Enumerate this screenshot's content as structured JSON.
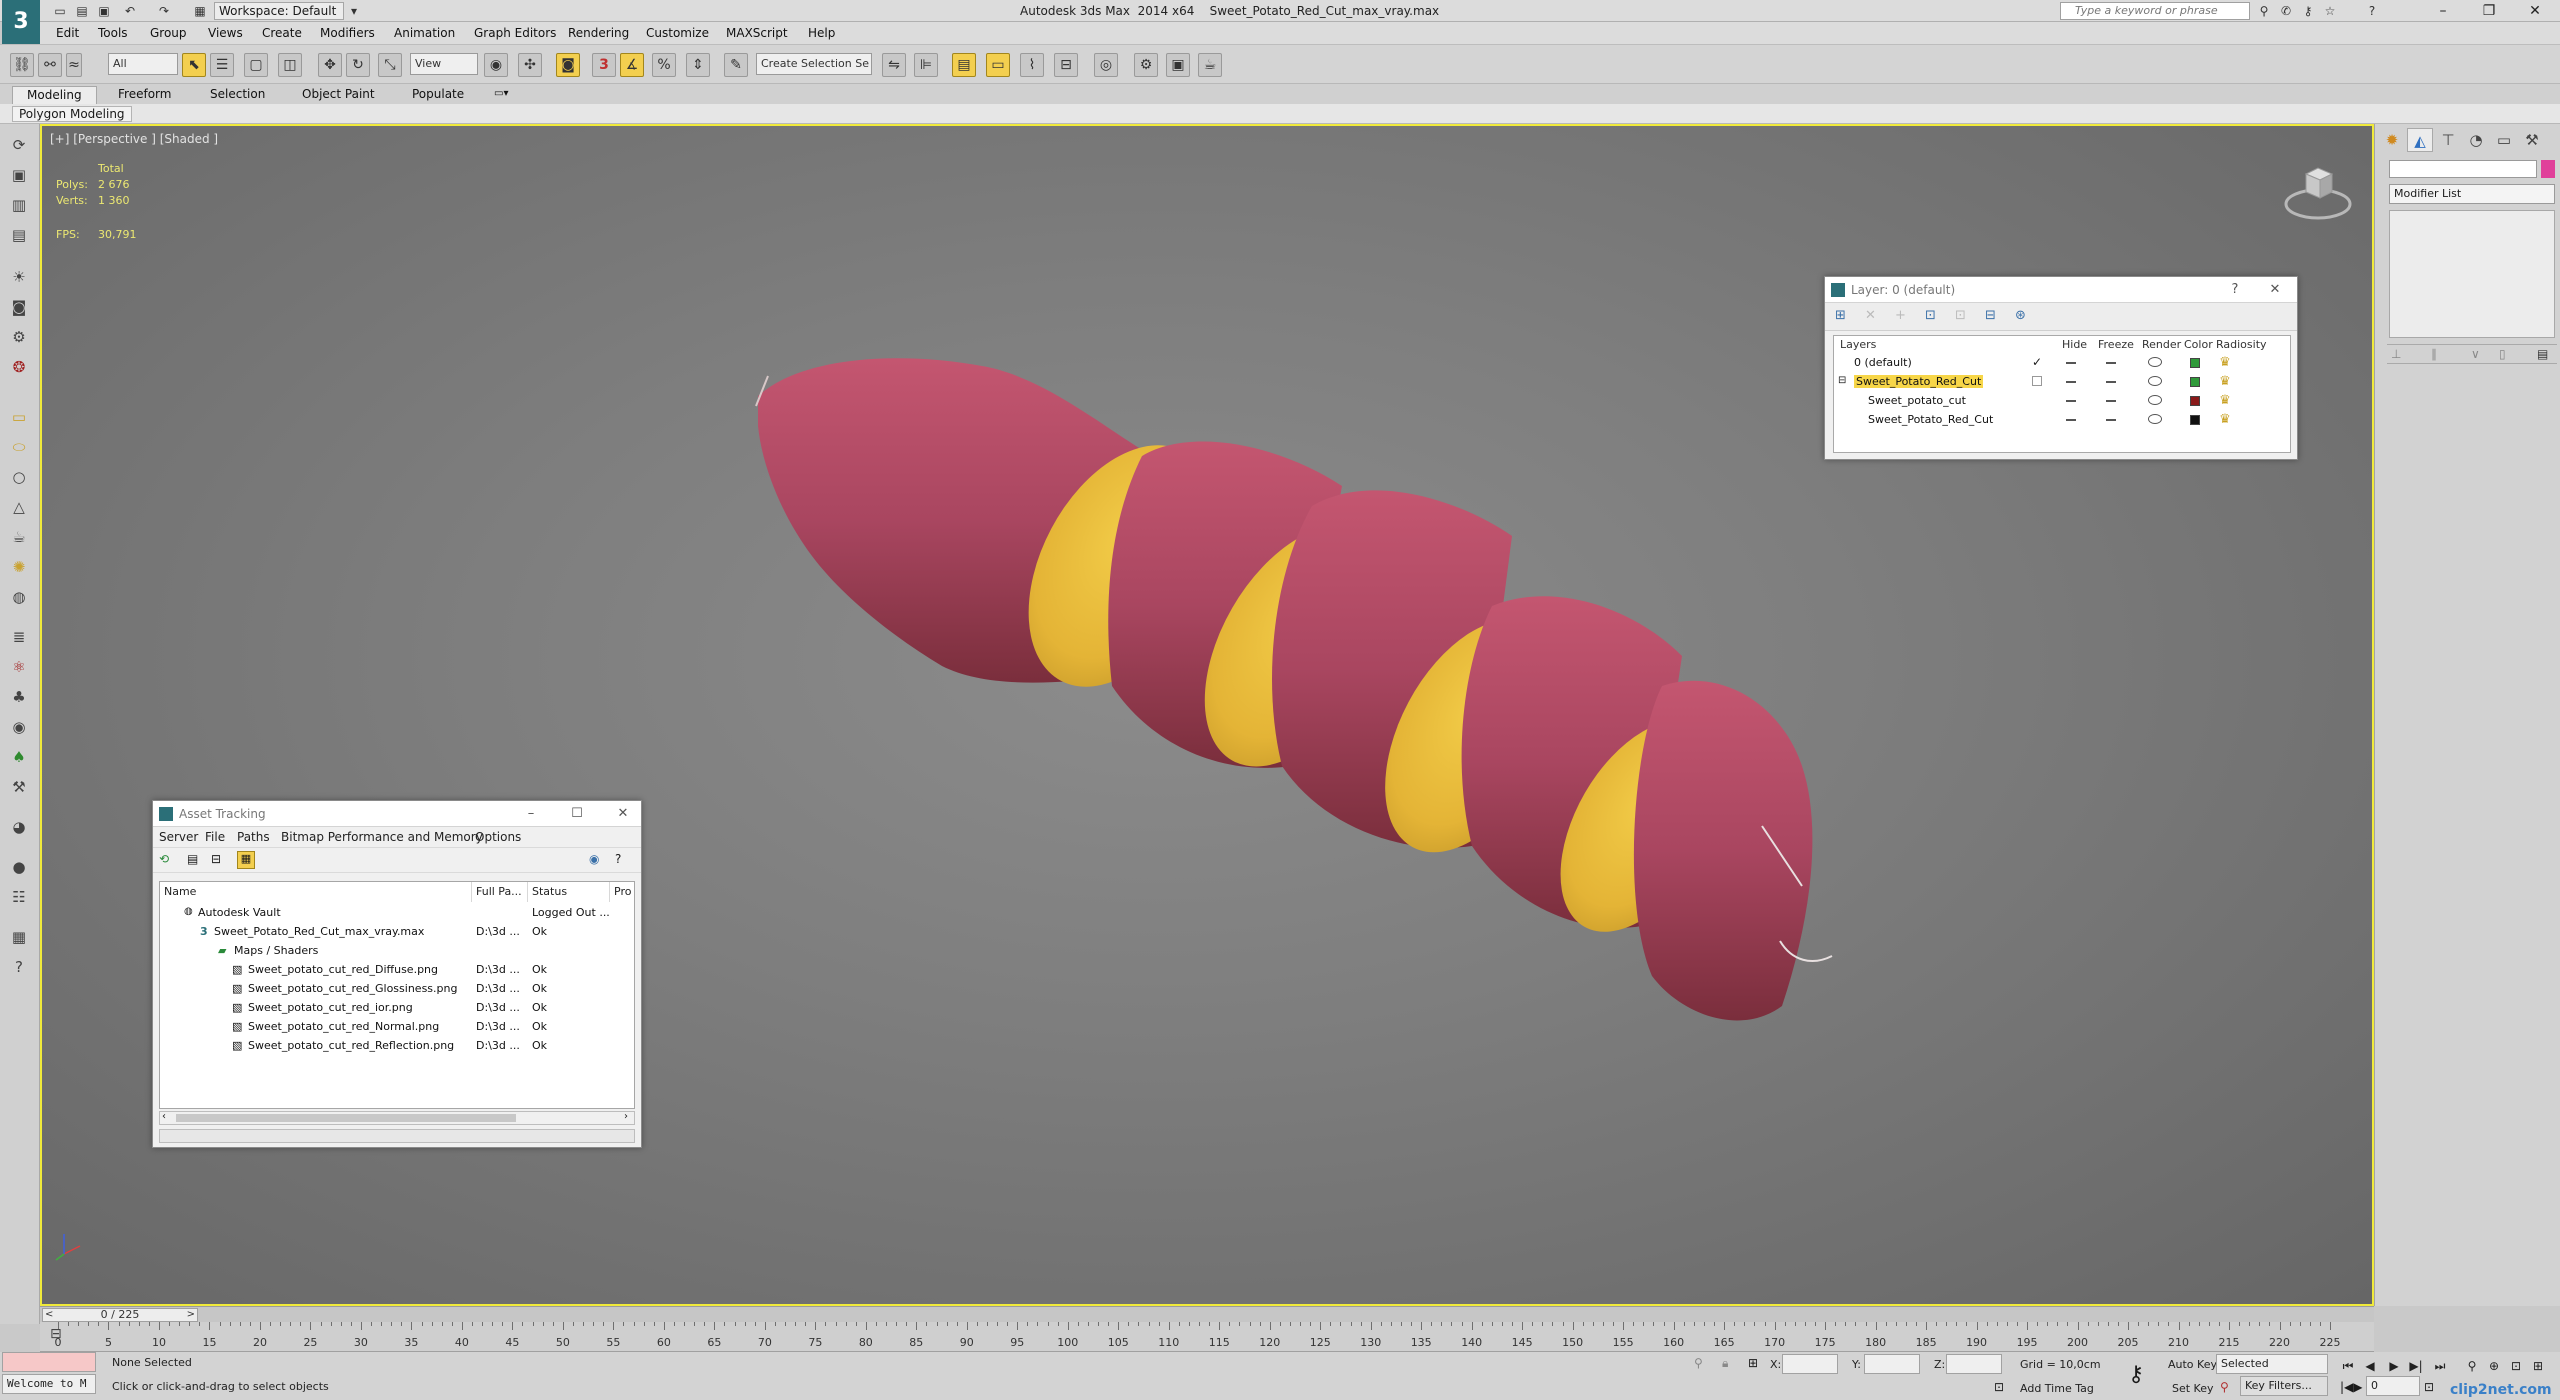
{
  "titlebar": {
    "title": "Autodesk 3ds Max  2014 x64    Sweet_Potato_Red_Cut_max_vray.max",
    "workspace": "Workspace: Default",
    "search_placeholder": "Type a keyword or phrase",
    "logo": "3"
  },
  "menu": [
    "Edit",
    "Tools",
    "Group",
    "Views",
    "Create",
    "Modifiers",
    "Animation",
    "Graph Editors",
    "Rendering",
    "Customize",
    "MAXScript",
    "Help"
  ],
  "toolbar": {
    "selection_filter": "All",
    "ref_coord": "View",
    "named_selection": "Create Selection Se",
    "snap_label": "3"
  },
  "ribbon": {
    "tabs": [
      "Modeling",
      "Freeform",
      "Selection",
      "Object Paint",
      "Populate"
    ],
    "sub": "Polygon Modeling"
  },
  "viewport": {
    "label": "[+] [Perspective ] [Shaded ]",
    "stats": {
      "total_label": "Total",
      "polys_label": "Polys:",
      "polys_value": "2 676",
      "verts_label": "Verts:",
      "verts_value": "1 360",
      "fps_label": "FPS:",
      "fps_value": "30,791"
    }
  },
  "command_panel": {
    "modifier_list": "Modifier List"
  },
  "layer_explorer": {
    "title": "Layer: 0 (default)",
    "headers": [
      "Layers",
      "Hide",
      "Freeze",
      "Render",
      "Color",
      "Radiosity"
    ],
    "rows": [
      {
        "name": "0 (default)",
        "color": "#2f9a3a",
        "selected": false
      },
      {
        "name": "Sweet_Potato_Red_Cut",
        "color": "#2f9a3a",
        "selected": true
      },
      {
        "name": "Sweet_potato_cut",
        "color": "#8a1a1a",
        "selected": false
      },
      {
        "name": "Sweet_Potato_Red_Cut",
        "color": "#111111",
        "selected": false
      }
    ]
  },
  "asset_tracking": {
    "title": "Asset Tracking",
    "menu": [
      "Server",
      "File",
      "Paths",
      "Bitmap Performance and Memory",
      "Options"
    ],
    "headers": [
      "Name",
      "Full Pa...",
      "Status",
      "Pro"
    ],
    "rows": [
      {
        "name": "Autodesk Vault",
        "path": "",
        "status": "Logged Out ..."
      },
      {
        "name": "Sweet_Potato_Red_Cut_max_vray.max",
        "path": "D:\\3d ...",
        "status": "Ok"
      },
      {
        "name": "Maps / Shaders",
        "path": "",
        "status": ""
      },
      {
        "name": "Sweet_potato_cut_red_Diffuse.png",
        "path": "D:\\3d ...",
        "status": "Ok"
      },
      {
        "name": "Sweet_potato_cut_red_Glossiness.png",
        "path": "D:\\3d ...",
        "status": "Ok"
      },
      {
        "name": "Sweet_potato_cut_red_ior.png",
        "path": "D:\\3d ...",
        "status": "Ok"
      },
      {
        "name": "Sweet_potato_cut_red_Normal.png",
        "path": "D:\\3d ...",
        "status": "Ok"
      },
      {
        "name": "Sweet_potato_cut_red_Reflection.png",
        "path": "D:\\3d ...",
        "status": "Ok"
      }
    ]
  },
  "timeline": {
    "frame_display": "0 / 225",
    "ticks": [
      "0",
      "5",
      "10",
      "15",
      "20",
      "25",
      "30",
      "35",
      "40",
      "45",
      "50",
      "55",
      "60",
      "65",
      "70",
      "75",
      "80",
      "85",
      "90",
      "95",
      "100",
      "105",
      "110",
      "115",
      "120",
      "125",
      "130",
      "135",
      "140",
      "145",
      "150",
      "155",
      "160",
      "165",
      "170",
      "175",
      "180",
      "185",
      "190",
      "195",
      "200",
      "205",
      "210",
      "215",
      "220",
      "225"
    ]
  },
  "status": {
    "listener": "Welcome to M",
    "selection": "None Selected",
    "prompt": "Click or click-and-drag to select objects",
    "x_label": "X:",
    "y_label": "Y:",
    "z_label": "Z:",
    "grid": "Grid = 10,0cm",
    "add_time_tag": "Add Time Tag",
    "auto_key": "Auto Key",
    "auto_key_mode": "Selected",
    "set_key": "Set Key",
    "key_filters": "Key Filters...",
    "current_frame": "0",
    "watermark": "clip2net.com"
  },
  "colors": {
    "viewport_border": "#f0ea3a",
    "selection_highlight": "#f7d648",
    "skin": "#b24a5e",
    "flesh": "#e8be3c"
  }
}
